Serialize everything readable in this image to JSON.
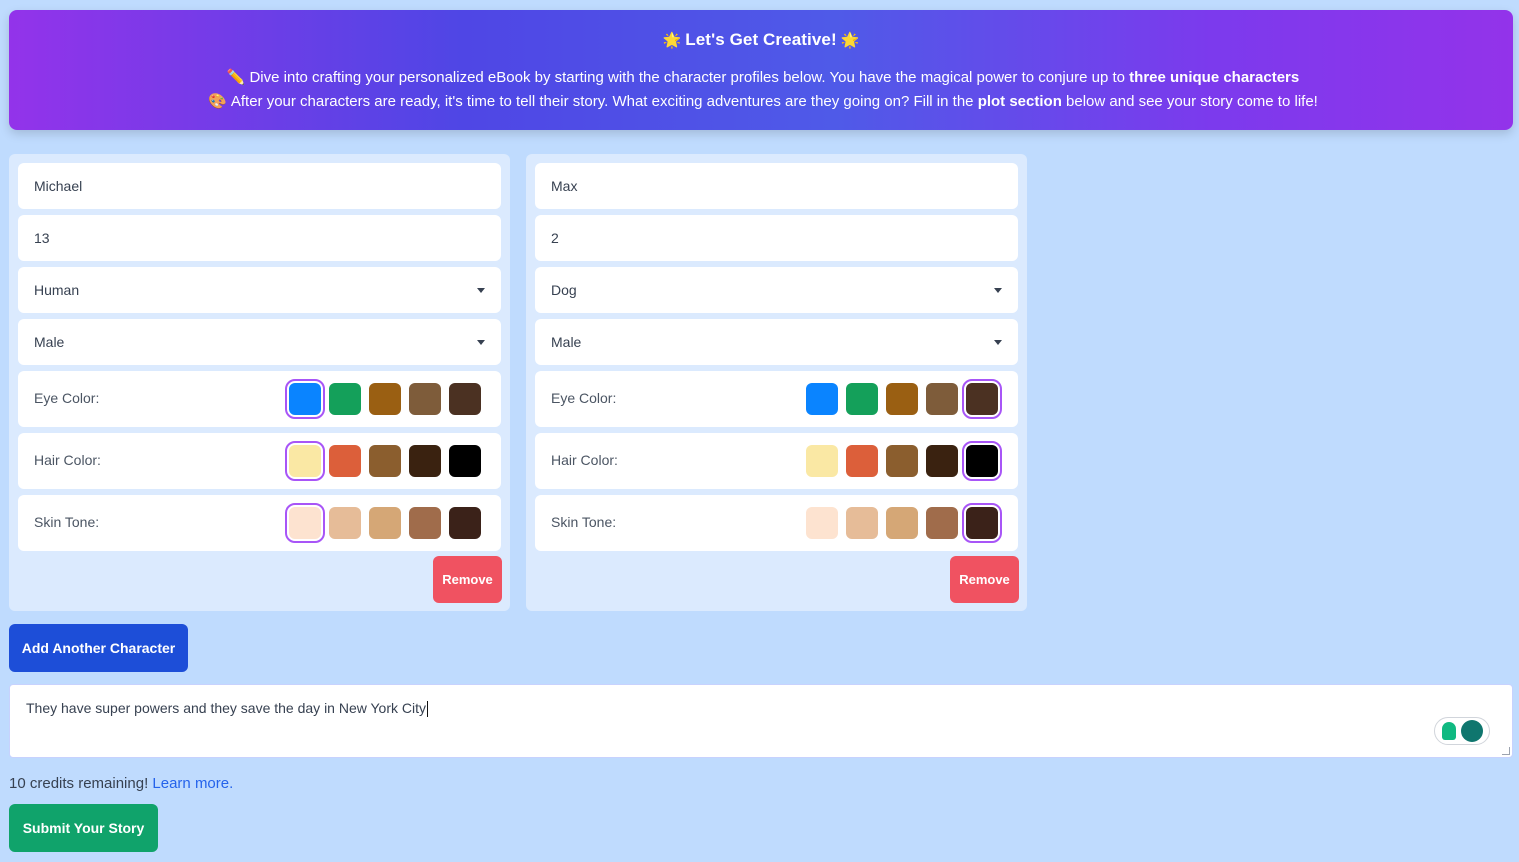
{
  "banner": {
    "title_emoji": "🌟",
    "title": "Let's Get Creative!",
    "line1_emoji": "✏️",
    "line1_text": "Dive into crafting your personalized eBook by starting with the character profiles below. You have the magical power to conjure up to",
    "line1_bold": "three unique characters",
    "line2_emoji": "🎨",
    "line2_text": "After your characters are ready, it's time to tell their story. What exciting adventures are they going on? Fill in the",
    "line2_bold": "plot section",
    "line2_tail": "below and see your story come to life!"
  },
  "characters": [
    {
      "name": "Michael",
      "age": "13",
      "species": "Human",
      "gender": "Male",
      "eye_label": "Eye Color:",
      "hair_label": "Hair Color:",
      "skin_label": "Skin Tone:",
      "eye_selected": 0,
      "hair_selected": 0,
      "skin_selected": 0,
      "remove_label": "Remove"
    },
    {
      "name": "Max",
      "age": "2",
      "species": "Dog",
      "gender": "Male",
      "eye_label": "Eye Color:",
      "hair_label": "Hair Color:",
      "skin_label": "Skin Tone:",
      "eye_selected": 4,
      "hair_selected": 4,
      "skin_selected": 4,
      "remove_label": "Remove"
    }
  ],
  "palettes": {
    "eye": [
      "#0a84ff",
      "#14a05a",
      "#9a5f12",
      "#7e5c3a",
      "#4b3122"
    ],
    "hair": [
      "#fae8a4",
      "#dc5f3a",
      "#8b5e2e",
      "#3a2210",
      "#000000"
    ],
    "skin": [
      "#fde3d0",
      "#e6bc98",
      "#d5a776",
      "#a06c4b",
      "#3b2219"
    ]
  },
  "add_button": "Add Another Character",
  "plot_text": "They have super powers and they save the day in New York City",
  "credits_text": "10 credits remaining!",
  "credits_link": "Learn more.",
  "submit_button": "Submit Your Story"
}
